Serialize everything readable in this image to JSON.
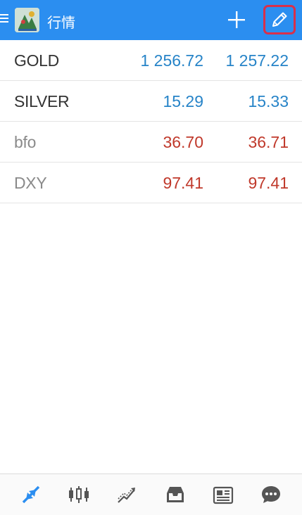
{
  "header": {
    "title": "行情",
    "bar_color": "#2b8ef0",
    "icons": [
      "menu-icon",
      "app-logo",
      "plus-icon",
      "pencil-icon"
    ]
  },
  "colors": {
    "up": "#2784c8",
    "down": "#c0392b",
    "symbol_active": "#333333",
    "symbol_inactive": "#8a8a8a",
    "nav_active": "#2b8ef0",
    "nav_inactive": "#555555",
    "highlight_border": "#d9304a"
  },
  "quotes": [
    {
      "symbol": "GOLD",
      "bid": "1 256.72",
      "ask": "1 257.22",
      "direction": "up",
      "active": true
    },
    {
      "symbol": "SILVER",
      "bid": "15.29",
      "ask": "15.33",
      "direction": "up",
      "active": true
    },
    {
      "symbol": "bfo",
      "bid": "36.70",
      "ask": "36.71",
      "direction": "down",
      "active": false
    },
    {
      "symbol": "DXY",
      "bid": "97.41",
      "ask": "97.41",
      "direction": "down",
      "active": false
    }
  ],
  "bottom_nav": [
    {
      "icon": "quotes-arrows-icon",
      "active": true
    },
    {
      "icon": "candlestick-chart-icon",
      "active": false
    },
    {
      "icon": "trade-icon",
      "active": false
    },
    {
      "icon": "inbox-icon",
      "active": false
    },
    {
      "icon": "news-icon",
      "active": false
    },
    {
      "icon": "chat-icon",
      "active": false
    }
  ]
}
